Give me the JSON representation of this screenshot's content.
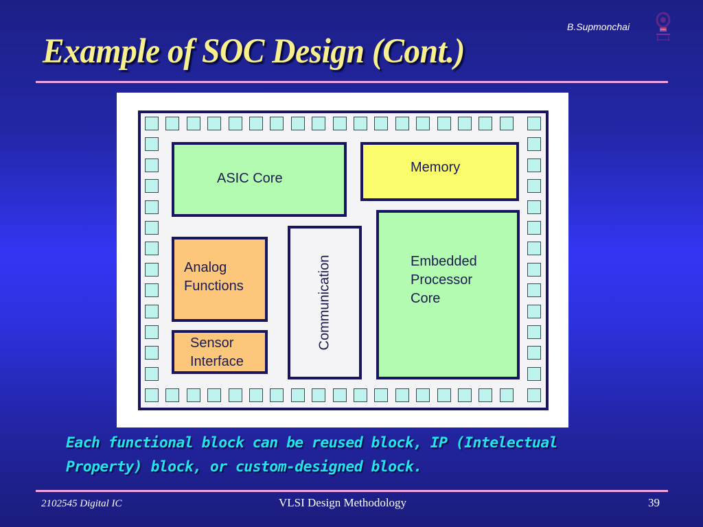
{
  "slide": {
    "author": "B.Supmonchai",
    "logo_icon": "university-emblem-icon",
    "title": "Example of SOC Design (Cont.)",
    "caption_lines": [
      "Each functional block can be reused block, IP (Intelectual",
      "Property) block, or custom-designed block."
    ],
    "footer": {
      "course": "2102545 Digital IC",
      "topic": "VLSI Design Methodology",
      "page_number": "39"
    },
    "colors": {
      "title": "#f8f08c",
      "caption": "#22e4f0",
      "rule": "#f2a6e6",
      "background_mid": "#3236f2",
      "background_edge": "#1c1f86"
    }
  },
  "diagram": {
    "chip_border_color": "#1a1360",
    "pad_color": "#bff3ee",
    "io_pads": {
      "top_count": 19,
      "bottom_count": 19,
      "left_count": 14,
      "right_count": 14
    },
    "blocks": [
      {
        "id": "asic",
        "label": "ASIC Core",
        "color": "#b4fbb2"
      },
      {
        "id": "memory",
        "label": "Memory",
        "color": "#fbfc6b"
      },
      {
        "id": "analog",
        "label": "Analog\nFunctions",
        "color": "#fdc77b"
      },
      {
        "id": "sensor",
        "label": "Sensor\nInterface",
        "color": "#fdc77b"
      },
      {
        "id": "comm",
        "label": "Communication",
        "color": "#f4f3f6"
      },
      {
        "id": "embedded",
        "label": "Embedded\nProcessor\nCore",
        "color": "#b4fbb2"
      }
    ]
  }
}
